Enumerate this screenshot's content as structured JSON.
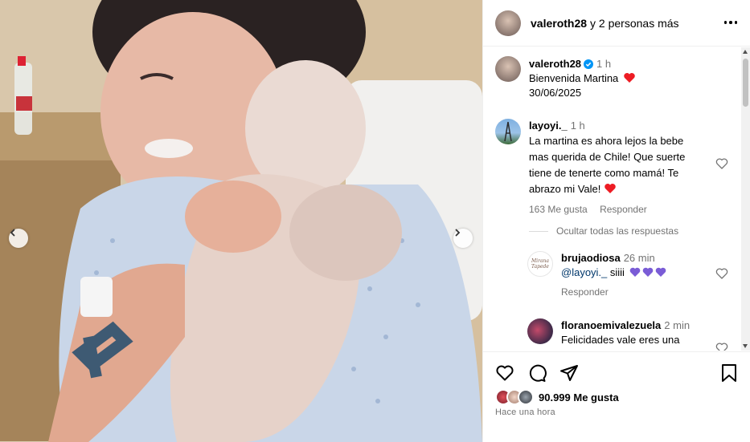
{
  "header": {
    "username": "valeroth28",
    "others": "y 2 personas más"
  },
  "caption": {
    "username": "valeroth28",
    "time": "1 h",
    "line1": "Bienvenida Martina",
    "line2": "30/06/2025"
  },
  "comments": [
    {
      "username": "layoyi._",
      "time": "1 h",
      "text": "La martina es ahora lejos la bebe mas querida de Chile! Que suerte tiene de tenerte como mamá! Te abrazo mi Vale!",
      "likes": "163 Me gusta",
      "reply": "Responder"
    }
  ],
  "hide_replies": "Ocultar todas las respuestas",
  "replies": [
    {
      "username": "brujaodiosa",
      "time": "26 min",
      "mention": "@layoyi._",
      "text": " siiii",
      "reply": "Responder",
      "avatar_text": "Mirana Tapede"
    },
    {
      "username": "floranoemivalezuela",
      "time": "2 min",
      "text": "Felicidades vale eres una"
    }
  ],
  "likes_text": "90.999 Me gusta",
  "posted": "Hace una hora",
  "colors": {
    "heart_red": "#ed1c24",
    "heart_purple": "#7a5cd6",
    "verified_blue": "#0095f6",
    "meta_gray": "#737373"
  }
}
